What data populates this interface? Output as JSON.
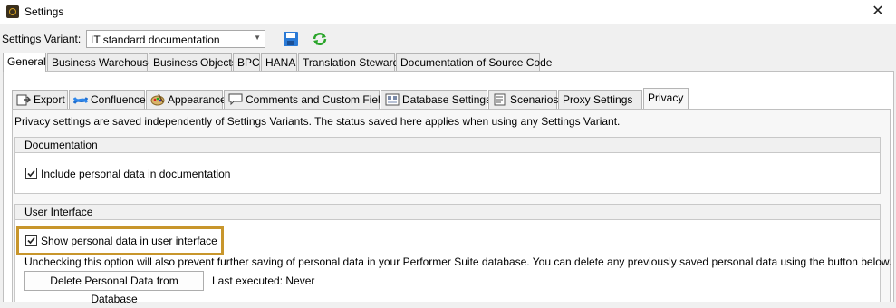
{
  "window": {
    "title": "Settings",
    "close_label": "✕"
  },
  "variant": {
    "label": "Settings Variant:",
    "selected": "IT standard documentation",
    "save_icon": "save-icon",
    "refresh_icon": "refresh-icon"
  },
  "top_tabs": [
    "General",
    "Business Warehouse",
    "Business Objects",
    "BPC",
    "HANA",
    "Translation Steward",
    "Documentation of Source Code"
  ],
  "sub_tabs": [
    "Export",
    "Confluence",
    "Appearance",
    "Comments and Custom Fields",
    "Database Settings",
    "Scenarios",
    "Proxy Settings",
    "Privacy"
  ],
  "privacy": {
    "info": "Privacy settings are saved independently of Settings Variants. The status saved here applies when using any Settings Variant.",
    "documentation": {
      "title": "Documentation",
      "checkbox_label": "Include personal data in documentation",
      "checked": true
    },
    "ui": {
      "title": "User Interface",
      "checkbox_label": "Show personal data in user interface",
      "checked": true,
      "note": "Unchecking this option will also prevent further saving of personal data in your Performer Suite database. You can delete any previously saved personal data using the button below.",
      "delete_button": "Delete Personal Data from Database",
      "last_executed": "Last executed: Never"
    }
  },
  "colors": {
    "highlight": "#c8962c",
    "save_blue": "#2a7ad6",
    "refresh_green": "#2aa52a"
  }
}
